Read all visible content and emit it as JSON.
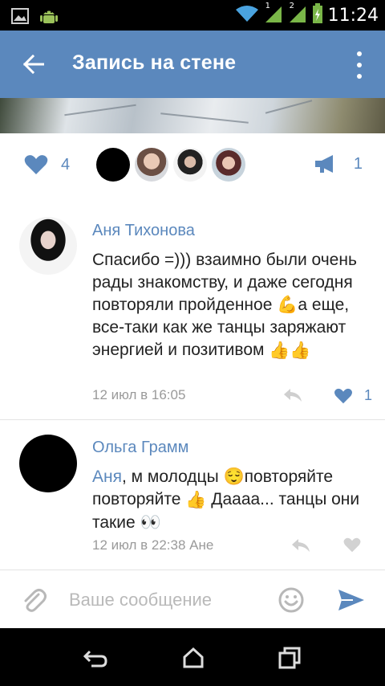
{
  "status_bar": {
    "time": "11:24",
    "icons": [
      "gallery-icon",
      "android-icon",
      "wifi-icon",
      "signal-sim1-icon",
      "signal-sim2-icon",
      "battery-charging-icon"
    ],
    "sim1_label": "1",
    "sim2_label": "2"
  },
  "app_bar": {
    "title": "Запись на стене",
    "back_icon": "arrow-left-icon",
    "menu_icon": "overflow-menu-icon",
    "color": "#5b88bd"
  },
  "post_stats": {
    "likes_count": "4",
    "shares_count": "1",
    "liked_avatars": [
      "black",
      "photo",
      "photo",
      "photo"
    ]
  },
  "comments": [
    {
      "author": "Аня Тихонова",
      "text_parts": [
        "Спасибо =))) взаимно были очень рады знакомству, и даже сегодня повторяли пройденное ",
        "💪",
        "а еще, все-таки как же танцы заряжают энергией и позитивом ",
        "👍👍"
      ],
      "date": "12 июл в 16:05",
      "likes": "1"
    },
    {
      "author": "Ольга Грамм",
      "mention": "Аня",
      "text_parts": [
        ", м молодцы ",
        "😌",
        "повторяйте повторяйте ",
        "👍",
        " Даааа... танцы они такие ",
        "👀"
      ],
      "date": "12 июл в 22:38 Ане"
    }
  ],
  "composer": {
    "placeholder": "Ваше сообщение"
  },
  "accent_color": "#5b88bd"
}
